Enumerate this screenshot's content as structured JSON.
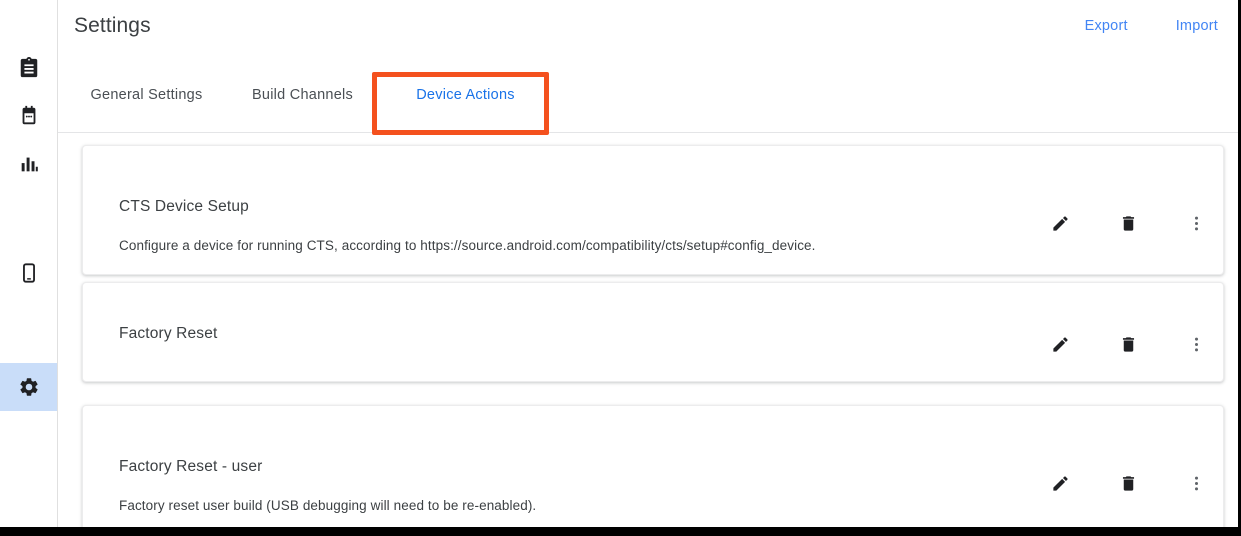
{
  "header": {
    "title": "Settings",
    "actions": [
      {
        "label": "Export",
        "name": "export-button"
      },
      {
        "label": "Import",
        "name": "import-button"
      }
    ]
  },
  "sidebar": {
    "items": [
      {
        "icon": "clipboard-icon",
        "name": "sidebar-item-tests",
        "selected": false
      },
      {
        "icon": "calendar-icon",
        "name": "sidebar-item-schedules",
        "selected": false
      },
      {
        "icon": "bar-chart-icon",
        "name": "sidebar-item-results",
        "selected": false
      },
      {
        "icon": "device-phone-icon",
        "name": "sidebar-item-devices",
        "selected": false
      },
      {
        "icon": "gear-icon",
        "name": "sidebar-item-settings",
        "selected": true
      }
    ]
  },
  "tabs": [
    {
      "label": "General Settings",
      "name": "tab-general-settings",
      "active": false
    },
    {
      "label": "Build Channels",
      "name": "tab-build-channels",
      "active": false
    },
    {
      "label": "Device Actions",
      "name": "tab-device-actions",
      "active": true
    }
  ],
  "annotation": {
    "target": "tab-device-actions",
    "color": "#f4511e"
  },
  "device_actions": [
    {
      "title": "CTS Device Setup",
      "description": "Configure a device for running CTS, according to https://source.android.com/compatibility/cts/setup#config_device."
    },
    {
      "title": "Factory Reset",
      "description": ""
    },
    {
      "title": "Factory Reset - user",
      "description": "Factory reset user build (USB debugging will need to be re-enabled)."
    }
  ],
  "row_actions": {
    "edit": "edit-icon",
    "delete": "delete-icon",
    "more": "more-vert-icon"
  },
  "colors": {
    "accent": "#1a73e8",
    "link": "#4285f4",
    "annotation": "#f4511e",
    "sidebar_selected": "#c9ddf9",
    "text": "#3c4043"
  }
}
